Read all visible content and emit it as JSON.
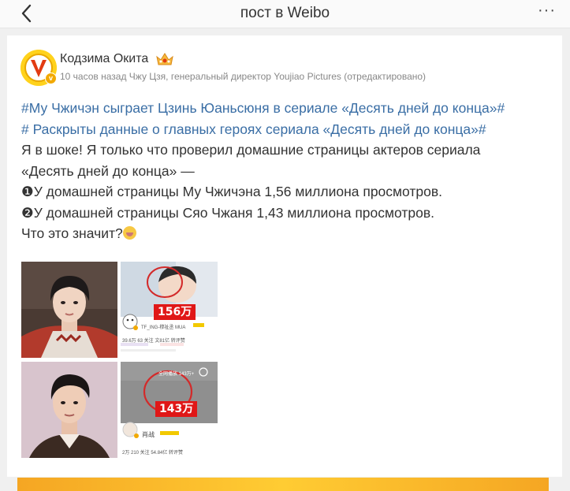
{
  "header": {
    "title": "пост в Weibo",
    "more_label": "···"
  },
  "post": {
    "author": "Кодзима Окита",
    "meta": "10 часов назад Чжу Цзя, генеральный директор Youjiao Pictures (отредактировано)",
    "tag1": "#Му Чжичэн сыграет Цзинь Юаньсюня в сериале «Десять дней до конца»#",
    "tag2": "# Раскрыты данные о главных героях сериала «Десять дней до конца»#",
    "line3": "Я в шоке! Я только что проверил домашние страницы актеров сериала",
    "line4": "«Десять дней до конца» —",
    "line5": "❶У домашней страницы Му Чжичэна 1,56 миллиона просмотров.",
    "line6": "❷У домашней страницы Сяо Чжаня 1,43 миллиона просмотров.",
    "line7": "Что это значит?"
  },
  "images": {
    "img2_label": "156万",
    "img2_name": "TF_ING-穆祉丞 MUA",
    "img2_stats": "39.6万    63 关注    文81亿 转评赞",
    "img4_label": "143万",
    "img4_top": "全网播放 143万+",
    "img4_name": "肖战",
    "img4_stats": "2万    210 关注    54.84亿 转评赞"
  },
  "colors": {
    "hashtag": "#3a6ea5",
    "label_red": "#e01717",
    "avatar_yellow": "#ffd21c"
  }
}
